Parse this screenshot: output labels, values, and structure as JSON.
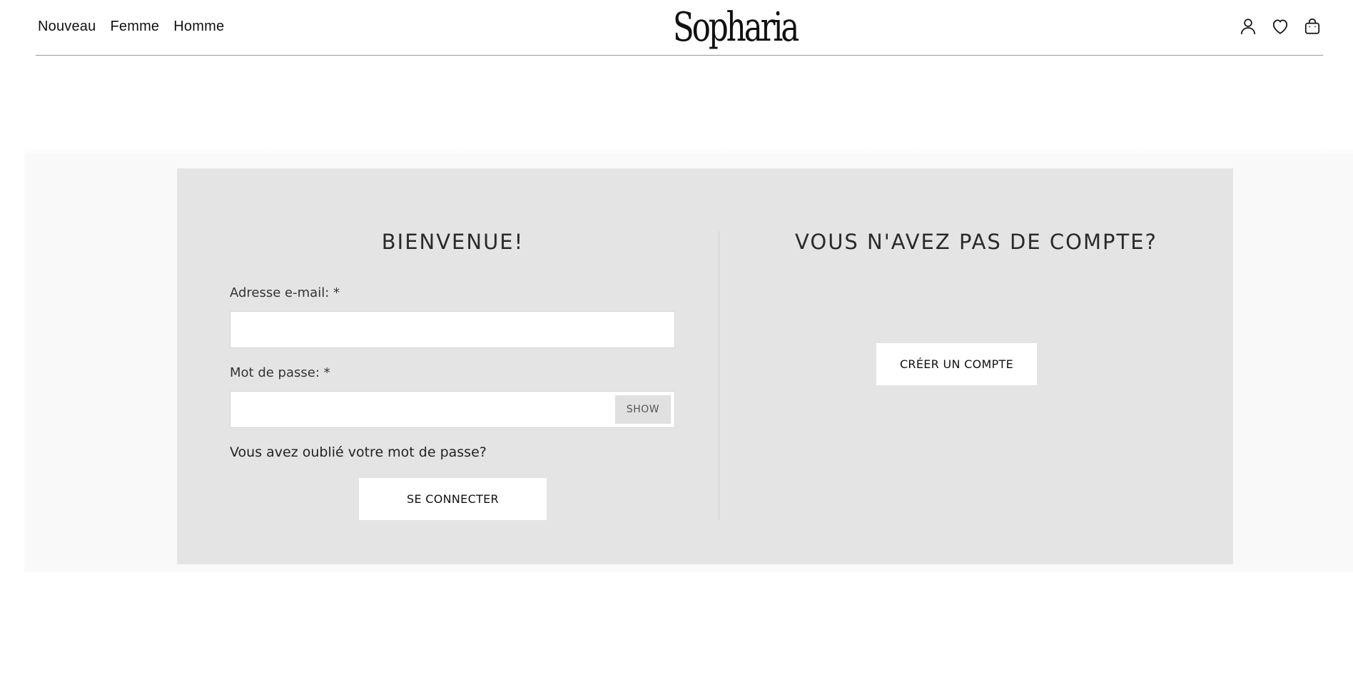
{
  "header": {
    "nav": [
      {
        "label": "Nouveau"
      },
      {
        "label": "Femme"
      },
      {
        "label": "Homme"
      }
    ],
    "logo_text": "Sopharia",
    "icons": [
      "user-icon",
      "heart-icon",
      "shopping-bag-icon"
    ]
  },
  "login": {
    "title": "BIENVENUE!",
    "email_label": "Adresse e-mail: *",
    "email_value": "",
    "password_label": "Mot de passe: *",
    "password_value": "",
    "show_label": "SHOW",
    "forgot_label": "Vous avez oublié votre mot de passe?",
    "submit_label": "SE CONNECTER"
  },
  "register": {
    "title": "VOUS N'AVEZ PAS DE COMPTE?",
    "create_label": "CRÉER UN COMPTE"
  },
  "colors": {
    "panel_bg": "#e4e4e4",
    "band_bg": "#f9f9f9",
    "text": "#1a1a1a"
  }
}
